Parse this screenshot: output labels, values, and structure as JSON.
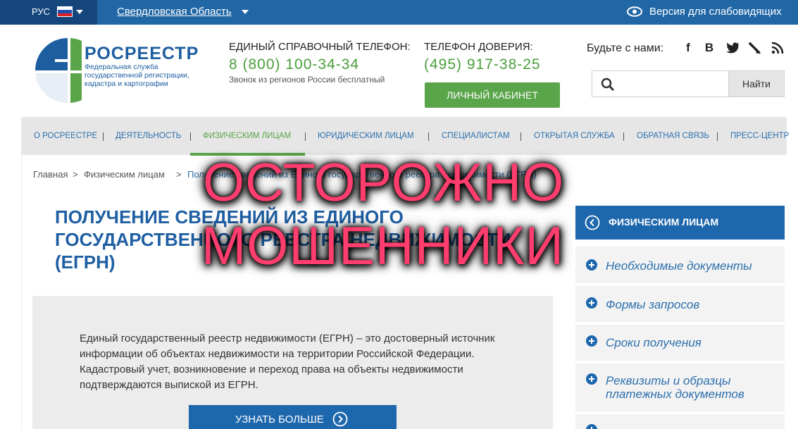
{
  "topbar": {
    "lang": "РУС",
    "region": "Свердловская Область",
    "vision": "Версия для слабовидящих",
    "flag_colors": [
      "#ffffff",
      "#1d4fb3",
      "#e02020"
    ]
  },
  "logo": {
    "name": "РОСРЕЕСТР",
    "subtitle": "Федеральная служба государственной регистрации, кадастра и картографии",
    "colors": {
      "blue": "#1d5ea0",
      "green": "#5aa44a"
    }
  },
  "contacts": {
    "helpline_label": "ЕДИНЫЙ СПРАВОЧНЫЙ ТЕЛЕФОН:",
    "helpline_number": "8 (800) 100-34-34",
    "helpline_note": "Звонок из регионов России бесплатный",
    "trust_label": "ТЕЛЕФОН ДОВЕРИЯ:",
    "trust_number": "(495) 917-38-25"
  },
  "cabinet_button": "ЛИЧНЫЙ КАБИНЕТ",
  "social": {
    "label": "Будьте с нами:",
    "icons": [
      "facebook-icon",
      "vkontakte-icon",
      "twitter-icon",
      "livejournal-icon",
      "rss-icon"
    ],
    "glyphs": [
      "f",
      "B",
      "t",
      "✎",
      "≋"
    ]
  },
  "search": {
    "placeholder": "",
    "button": "Найти"
  },
  "nav": {
    "items": [
      {
        "label": "О РОСРЕЕСТРЕ"
      },
      {
        "label": "ДЕЯТЕЛЬНОСТЬ"
      },
      {
        "label": "ФИЗИЧЕСКИМ ЛИЦАМ",
        "active": true
      },
      {
        "label": "ЮРИДИЧЕСКИМ ЛИЦАМ"
      },
      {
        "label": "СПЕЦИАЛИСТАМ"
      },
      {
        "label": "ОТКРЫТАЯ СЛУЖБА"
      },
      {
        "label": "ОБРАТНАЯ СВЯЗЬ"
      },
      {
        "label": "ПРЕСС-ЦЕНТР"
      }
    ],
    "separator": "|"
  },
  "breadcrumb": {
    "home": "Главная",
    "sep": ">",
    "section": "Физическим лицам",
    "current": "Получение сведений из Единого государственного реестра недвижимости (ЕГРН)"
  },
  "page": {
    "title": "ПОЛУЧЕНИЕ СВЕДЕНИЙ ИЗ ЕДИНОГО ГОСУДАРСТВЕННОГО РЕЕСТРА НЕДВИЖИМОСТИ (ЕГРН)",
    "intro": "Единый государственный реестр недвижимости (ЕГРН) – это достоверный источник информации об объектах недвижимости на территории Российской Федерации. Кадастровый учет, возникновение и переход права на объекты недвижимости подтверждаются выпиской из ЕГРН.",
    "more_button": "УЗНАТЬ БОЛЬШЕ"
  },
  "sidebar": {
    "title": "ФИЗИЧЕСКИМ ЛИЦАМ",
    "items": [
      {
        "label": "Необходимые документы"
      },
      {
        "label": "Формы запросов"
      },
      {
        "label": "Сроки получения"
      },
      {
        "label": "Реквизиты и образцы платежных документов"
      }
    ]
  },
  "overlay": {
    "line1": "ОСТОРОЖНО",
    "line2": "МОШЕННИКИ",
    "color": "#ff3d6e"
  }
}
